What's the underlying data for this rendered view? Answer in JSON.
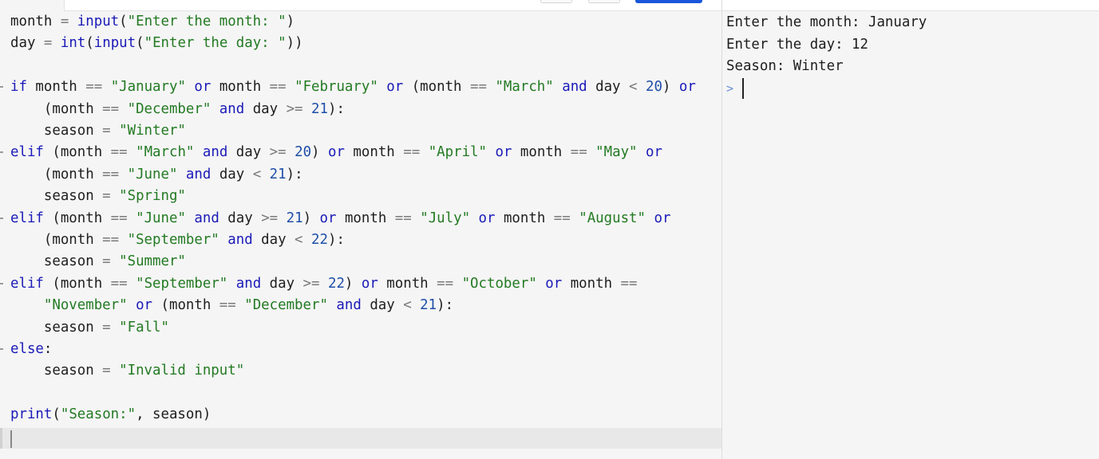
{
  "editor": {
    "lines": [
      [
        [
          "id",
          "month"
        ],
        [
          "op",
          " = "
        ],
        [
          "fn",
          "input"
        ],
        [
          "pn",
          "("
        ],
        [
          "str",
          "\"Enter the month: \""
        ],
        [
          "pn",
          ")"
        ]
      ],
      [
        [
          "id",
          "day"
        ],
        [
          "op",
          " = "
        ],
        [
          "fn",
          "int"
        ],
        [
          "pn",
          "("
        ],
        [
          "fn",
          "input"
        ],
        [
          "pn",
          "("
        ],
        [
          "str",
          "\"Enter the day: \""
        ],
        [
          "pn",
          "))"
        ]
      ],
      [],
      [
        [
          "kw",
          "if"
        ],
        [
          "id",
          " month "
        ],
        [
          "op",
          "=="
        ],
        [
          "id",
          " "
        ],
        [
          "str",
          "\"January\""
        ],
        [
          "id",
          " "
        ],
        [
          "kw",
          "or"
        ],
        [
          "id",
          " month "
        ],
        [
          "op",
          "=="
        ],
        [
          "id",
          " "
        ],
        [
          "str",
          "\"February\""
        ],
        [
          "id",
          " "
        ],
        [
          "kw",
          "or"
        ],
        [
          "pn",
          " (month "
        ],
        [
          "op",
          "=="
        ],
        [
          "id",
          " "
        ],
        [
          "str",
          "\"March\""
        ],
        [
          "id",
          " "
        ],
        [
          "kw",
          "and"
        ],
        [
          "id",
          " day "
        ],
        [
          "op",
          "<"
        ],
        [
          "id",
          " "
        ],
        [
          "num",
          "20"
        ],
        [
          "pn",
          ") "
        ],
        [
          "kw",
          "or"
        ]
      ],
      [
        [
          "pn",
          "    (month "
        ],
        [
          "op",
          "=="
        ],
        [
          "id",
          " "
        ],
        [
          "str",
          "\"December\""
        ],
        [
          "id",
          " "
        ],
        [
          "kw",
          "and"
        ],
        [
          "id",
          " day "
        ],
        [
          "op",
          ">="
        ],
        [
          "id",
          " "
        ],
        [
          "num",
          "21"
        ],
        [
          "pn",
          "):"
        ]
      ],
      [
        [
          "id",
          "    season "
        ],
        [
          "op",
          "="
        ],
        [
          "id",
          " "
        ],
        [
          "str",
          "\"Winter\""
        ]
      ],
      [
        [
          "kw",
          "elif"
        ],
        [
          "pn",
          " (month "
        ],
        [
          "op",
          "=="
        ],
        [
          "id",
          " "
        ],
        [
          "str",
          "\"March\""
        ],
        [
          "id",
          " "
        ],
        [
          "kw",
          "and"
        ],
        [
          "id",
          " day "
        ],
        [
          "op",
          ">="
        ],
        [
          "id",
          " "
        ],
        [
          "num",
          "20"
        ],
        [
          "pn",
          ") "
        ],
        [
          "kw",
          "or"
        ],
        [
          "id",
          " month "
        ],
        [
          "op",
          "=="
        ],
        [
          "id",
          " "
        ],
        [
          "str",
          "\"April\""
        ],
        [
          "id",
          " "
        ],
        [
          "kw",
          "or"
        ],
        [
          "id",
          " month "
        ],
        [
          "op",
          "=="
        ],
        [
          "id",
          " "
        ],
        [
          "str",
          "\"May\""
        ],
        [
          "id",
          " "
        ],
        [
          "kw",
          "or"
        ]
      ],
      [
        [
          "pn",
          "    (month "
        ],
        [
          "op",
          "=="
        ],
        [
          "id",
          " "
        ],
        [
          "str",
          "\"June\""
        ],
        [
          "id",
          " "
        ],
        [
          "kw",
          "and"
        ],
        [
          "id",
          " day "
        ],
        [
          "op",
          "<"
        ],
        [
          "id",
          " "
        ],
        [
          "num",
          "21"
        ],
        [
          "pn",
          "):"
        ]
      ],
      [
        [
          "id",
          "    season "
        ],
        [
          "op",
          "="
        ],
        [
          "id",
          " "
        ],
        [
          "str",
          "\"Spring\""
        ]
      ],
      [
        [
          "kw",
          "elif"
        ],
        [
          "pn",
          " (month "
        ],
        [
          "op",
          "=="
        ],
        [
          "id",
          " "
        ],
        [
          "str",
          "\"June\""
        ],
        [
          "id",
          " "
        ],
        [
          "kw",
          "and"
        ],
        [
          "id",
          " day "
        ],
        [
          "op",
          ">="
        ],
        [
          "id",
          " "
        ],
        [
          "num",
          "21"
        ],
        [
          "pn",
          ") "
        ],
        [
          "kw",
          "or"
        ],
        [
          "id",
          " month "
        ],
        [
          "op",
          "=="
        ],
        [
          "id",
          " "
        ],
        [
          "str",
          "\"July\""
        ],
        [
          "id",
          " "
        ],
        [
          "kw",
          "or"
        ],
        [
          "id",
          " month "
        ],
        [
          "op",
          "=="
        ],
        [
          "id",
          " "
        ],
        [
          "str",
          "\"August\""
        ],
        [
          "id",
          " "
        ],
        [
          "kw",
          "or"
        ]
      ],
      [
        [
          "pn",
          "    (month "
        ],
        [
          "op",
          "=="
        ],
        [
          "id",
          " "
        ],
        [
          "str",
          "\"September\""
        ],
        [
          "id",
          " "
        ],
        [
          "kw",
          "and"
        ],
        [
          "id",
          " day "
        ],
        [
          "op",
          "<"
        ],
        [
          "id",
          " "
        ],
        [
          "num",
          "22"
        ],
        [
          "pn",
          "):"
        ]
      ],
      [
        [
          "id",
          "    season "
        ],
        [
          "op",
          "="
        ],
        [
          "id",
          " "
        ],
        [
          "str",
          "\"Summer\""
        ]
      ],
      [
        [
          "kw",
          "elif"
        ],
        [
          "pn",
          " (month "
        ],
        [
          "op",
          "=="
        ],
        [
          "id",
          " "
        ],
        [
          "str",
          "\"September\""
        ],
        [
          "id",
          " "
        ],
        [
          "kw",
          "and"
        ],
        [
          "id",
          " day "
        ],
        [
          "op",
          ">="
        ],
        [
          "id",
          " "
        ],
        [
          "num",
          "22"
        ],
        [
          "pn",
          ") "
        ],
        [
          "kw",
          "or"
        ],
        [
          "id",
          " month "
        ],
        [
          "op",
          "=="
        ],
        [
          "id",
          " "
        ],
        [
          "str",
          "\"October\""
        ],
        [
          "id",
          " "
        ],
        [
          "kw",
          "or"
        ],
        [
          "id",
          " month "
        ],
        [
          "op",
          "=="
        ]
      ],
      [
        [
          "id",
          "    "
        ],
        [
          "str",
          "\"November\""
        ],
        [
          "id",
          " "
        ],
        [
          "kw",
          "or"
        ],
        [
          "pn",
          " (month "
        ],
        [
          "op",
          "=="
        ],
        [
          "id",
          " "
        ],
        [
          "str",
          "\"December\""
        ],
        [
          "id",
          " "
        ],
        [
          "kw",
          "and"
        ],
        [
          "id",
          " day "
        ],
        [
          "op",
          "<"
        ],
        [
          "id",
          " "
        ],
        [
          "num",
          "21"
        ],
        [
          "pn",
          "):"
        ]
      ],
      [
        [
          "id",
          "    season "
        ],
        [
          "op",
          "="
        ],
        [
          "id",
          " "
        ],
        [
          "str",
          "\"Fall\""
        ]
      ],
      [
        [
          "kw",
          "else"
        ],
        [
          "pn",
          ":"
        ]
      ],
      [
        [
          "id",
          "    season "
        ],
        [
          "op",
          "="
        ],
        [
          "id",
          " "
        ],
        [
          "str",
          "\"Invalid input\""
        ]
      ],
      [],
      [
        [
          "fn",
          "print"
        ],
        [
          "pn",
          "("
        ],
        [
          "str",
          "\"Season:\""
        ],
        [
          "pn",
          ", season)"
        ]
      ]
    ],
    "fold_lines": [
      3,
      6,
      9,
      12,
      15
    ]
  },
  "console": {
    "lines": [
      "Enter the month: January",
      "Enter the day: 12",
      "Season: Winter"
    ],
    "prompt": ">"
  }
}
